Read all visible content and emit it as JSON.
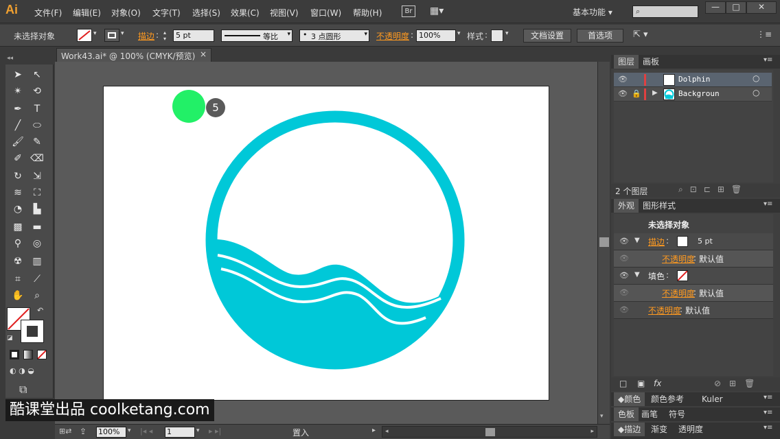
{
  "app": {
    "logo": "Ai",
    "workspace": "基本功能"
  },
  "menu": [
    "文件(F)",
    "编辑(E)",
    "对象(O)",
    "文字(T)",
    "选择(S)",
    "效果(C)",
    "视图(V)",
    "窗口(W)",
    "帮助(H)"
  ],
  "bridge": "Br",
  "window_buttons": [
    "—",
    "□",
    "✕"
  ],
  "control_bar": {
    "selection": "未选择对象",
    "stroke_label": "描边",
    "stroke_value": "5 pt",
    "stroke_profile": "等比",
    "brush": "3 点圆形",
    "opacity_label": "不透明度",
    "opacity_value": "100%",
    "style_label": "样式",
    "doc_setup": "文档设置",
    "preferences": "首选项"
  },
  "document": {
    "tab_title": "Work43.ai* @ 100% (CMYK/预览)",
    "close": "×"
  },
  "canvas": {
    "badge": "5",
    "shape_color": "#00c8d8",
    "dot_color": "#22f067"
  },
  "status": {
    "zoom": "100%",
    "page": "1",
    "info": "置入"
  },
  "layers_panel": {
    "tabs": [
      "图层",
      "画板"
    ],
    "layers": [
      {
        "name": "Dolphin",
        "color": "#e04040"
      },
      {
        "name": "Backgroun",
        "color": "#e04040"
      }
    ],
    "footer": "2 个图层"
  },
  "appearance_panel": {
    "tabs": [
      "外观",
      "图形样式"
    ],
    "title": "未选择对象",
    "rows": [
      {
        "label": "描边",
        "value": "5 pt",
        "orange": true
      },
      {
        "label": "不透明度",
        "value": "默认值",
        "orange": true,
        "sub": true
      },
      {
        "label": "填色",
        "value": "",
        "orange": false
      },
      {
        "label": "不透明度",
        "value": "默认值",
        "orange": true,
        "sub": true
      },
      {
        "label": "不透明度",
        "value": "默认值",
        "orange": true
      }
    ],
    "fx": "fx"
  },
  "color_panel_tabs": [
    "颜色",
    "颜色参考",
    "Kuler"
  ],
  "swatch_panel_tabs": [
    "色板",
    "画笔",
    "符号"
  ],
  "stroke_panel_tabs": [
    "描边",
    "渐变",
    "透明度"
  ],
  "watermark": "酷课堂出品 coolketang.com"
}
